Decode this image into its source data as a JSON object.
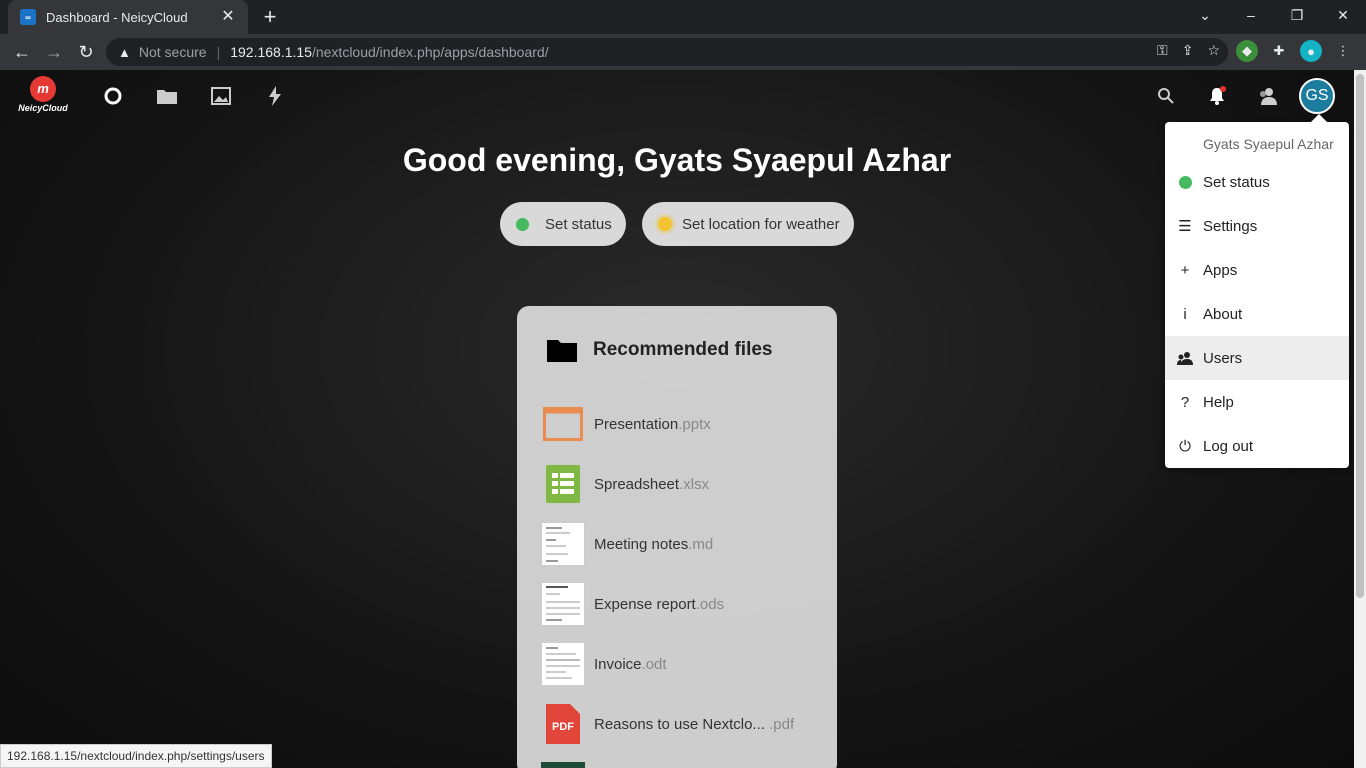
{
  "browser": {
    "tab_title": "Dashboard - NeicyCloud",
    "tab_close": "✕",
    "new_tab": "+",
    "not_secure": "Not secure",
    "url_host": "192.168.1.15",
    "url_path": "/nextcloud/index.php/apps/dashboard/",
    "status_url": "192.168.1.15/nextcloud/index.php/settings/users"
  },
  "header": {
    "logo_text": "NeicyCloud",
    "avatar_initials": "GS"
  },
  "dashboard": {
    "greeting": "Good evening, Gyats Syaepul Azhar",
    "set_status": "Set status",
    "set_weather": "Set location for weather"
  },
  "widget": {
    "title": "Recommended files",
    "files": [
      {
        "name": "Presentation",
        "ext": ".pptx"
      },
      {
        "name": "Spreadsheet",
        "ext": ".xlsx"
      },
      {
        "name": "Meeting notes",
        "ext": ".md"
      },
      {
        "name": "Expense report",
        "ext": ".ods"
      },
      {
        "name": "Invoice",
        "ext": ".odt"
      },
      {
        "name": "Reasons to use Nextclo... ",
        "ext": ".pdf"
      }
    ],
    "pdf_label": "PDF"
  },
  "menu": {
    "user_name": "Gyats Syaepul Azhar",
    "items": [
      {
        "label": "Set status",
        "icon": "status-dot-icon"
      },
      {
        "label": "Settings",
        "icon": "settings-list-icon"
      },
      {
        "label": "Apps",
        "icon": "plus-icon"
      },
      {
        "label": "About",
        "icon": "info-icon"
      },
      {
        "label": "Users",
        "icon": "users-icon"
      },
      {
        "label": "Help",
        "icon": "help-icon"
      },
      {
        "label": "Log out",
        "icon": "power-icon"
      }
    ]
  },
  "colors": {
    "status_online": "#46ba61",
    "avatar": "#1c7c9e",
    "notification": "#e9322d"
  }
}
